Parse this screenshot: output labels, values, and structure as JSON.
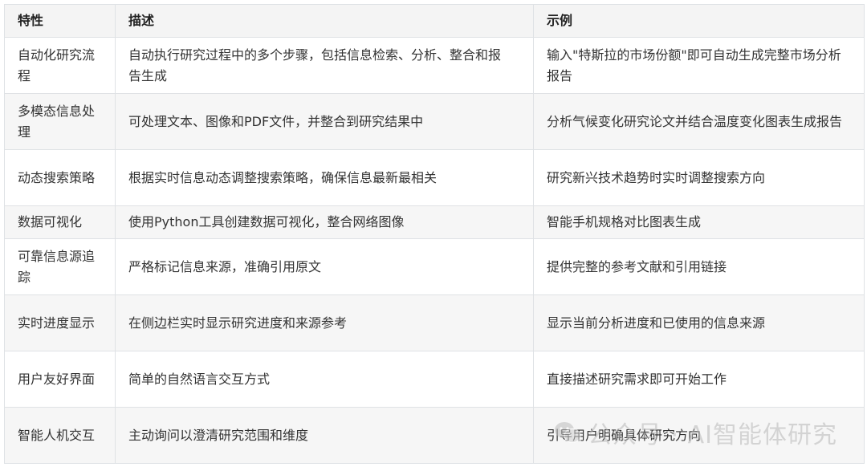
{
  "table": {
    "headers": [
      "特性",
      "描述",
      "示例"
    ],
    "rows": [
      {
        "feature": "自动化研究流程",
        "description": "自动执行研究过程中的多个步骤，包括信息检索、分析、整合和报告生成",
        "example": "输入\"特斯拉的市场份额\"即可自动生成完整市场分析报告"
      },
      {
        "feature": "多模态信息处理",
        "description": "可处理文本、图像和PDF文件，并整合到研究结果中",
        "example": "分析气候变化研究论文并结合温度变化图表生成报告"
      },
      {
        "feature": "动态搜索策略",
        "description": "根据实时信息动态调整搜索策略，确保信息最新最相关",
        "example": "研究新兴技术趋势时实时调整搜索方向"
      },
      {
        "feature": "数据可视化",
        "description": "使用Python工具创建数据可视化，整合网络图像",
        "example": "智能手机规格对比图表生成"
      },
      {
        "feature": "可靠信息源追踪",
        "description": "严格标记信息来源，准确引用原文",
        "example": "提供完整的参考文献和引用链接"
      },
      {
        "feature": "实时进度显示",
        "description": "在侧边栏实时显示研究进度和来源参考",
        "example": "显示当前分析进度和已使用的信息来源"
      },
      {
        "feature": "用户友好界面",
        "description": "简单的自然语言交互方式",
        "example": "直接描述研究需求即可开始工作"
      },
      {
        "feature": "智能人机交互",
        "description": "主动询问以澄清研究范围和维度",
        "example": "引导用户明确具体研究方向"
      }
    ]
  },
  "watermark": {
    "text": "公众号 · AI智能体研究",
    "icon": "wechat-icon"
  }
}
